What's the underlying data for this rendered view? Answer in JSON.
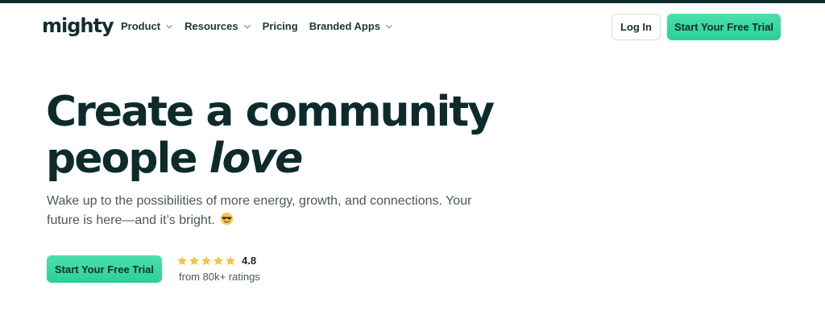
{
  "nav": {
    "logo": "mighty",
    "links": [
      {
        "label": "Product",
        "has_dropdown": true
      },
      {
        "label": "Resources",
        "has_dropdown": true
      },
      {
        "label": "Pricing",
        "has_dropdown": false
      },
      {
        "label": "Branded Apps",
        "has_dropdown": true
      }
    ],
    "login_label": "Log In",
    "trial_label": "Start Your Free Trial"
  },
  "hero": {
    "title_line1": "Create a community",
    "title_line2_prefix": "people ",
    "title_line2_emphasis": "love",
    "subtitle": "Wake up to the possibilities of more energy, growth, and connections. Your future is here—and it’s bright.",
    "emoji": "smiling-face-with-sunglasses-icon",
    "cta_label": "Start Your Free Trial"
  },
  "rating": {
    "stars": 5,
    "score": "4.8",
    "count_text": "from 80k+ ratings"
  },
  "colors": {
    "accent": "#2bcf98",
    "dark": "#0c2b2b",
    "star": "#f6c33d"
  }
}
